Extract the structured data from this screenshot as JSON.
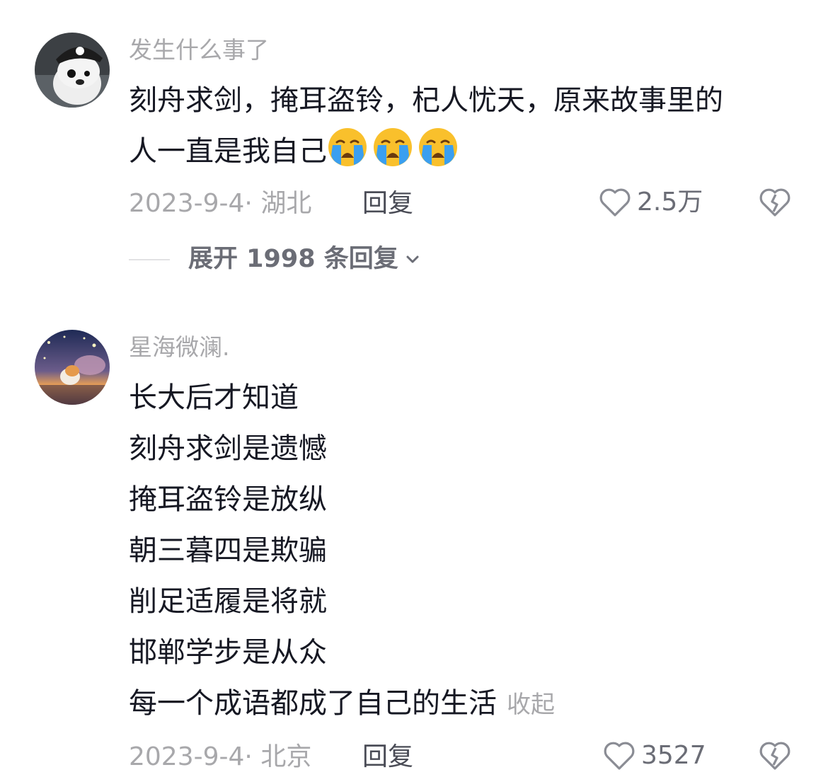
{
  "comments": [
    {
      "username": "发生什么事了",
      "text_line1": "刻舟求剑，掩耳盗铃，杞人忧天，原来故事里的",
      "text_line2": "人一直是我自己",
      "emoji_name": "loudly-crying-face-icon",
      "emoji_count": 3,
      "date": "2023-9-4·",
      "location": "湖北",
      "reply_label": "回复",
      "likes": "2.5万",
      "expand_label": "展开 1998 条回复"
    },
    {
      "username": "星海微澜.",
      "lines": [
        "长大后才知道",
        "刻舟求剑是遗憾",
        "掩耳盗铃是放纵",
        "朝三暮四是欺骗",
        "削足适履是将就",
        "邯郸学步是从众",
        "每一个成语都成了自己的生活"
      ],
      "collapse_label": "收起",
      "date": "2023-9-4·",
      "location": "北京",
      "reply_label": "回复",
      "likes": "3527"
    }
  ],
  "colors": {
    "text_primary": "#161823",
    "text_secondary": "#a8a8ab",
    "reply": "#4a4c56",
    "emoji_yellow": "#f9c02c",
    "emoji_tears": "#3a9ff0"
  }
}
